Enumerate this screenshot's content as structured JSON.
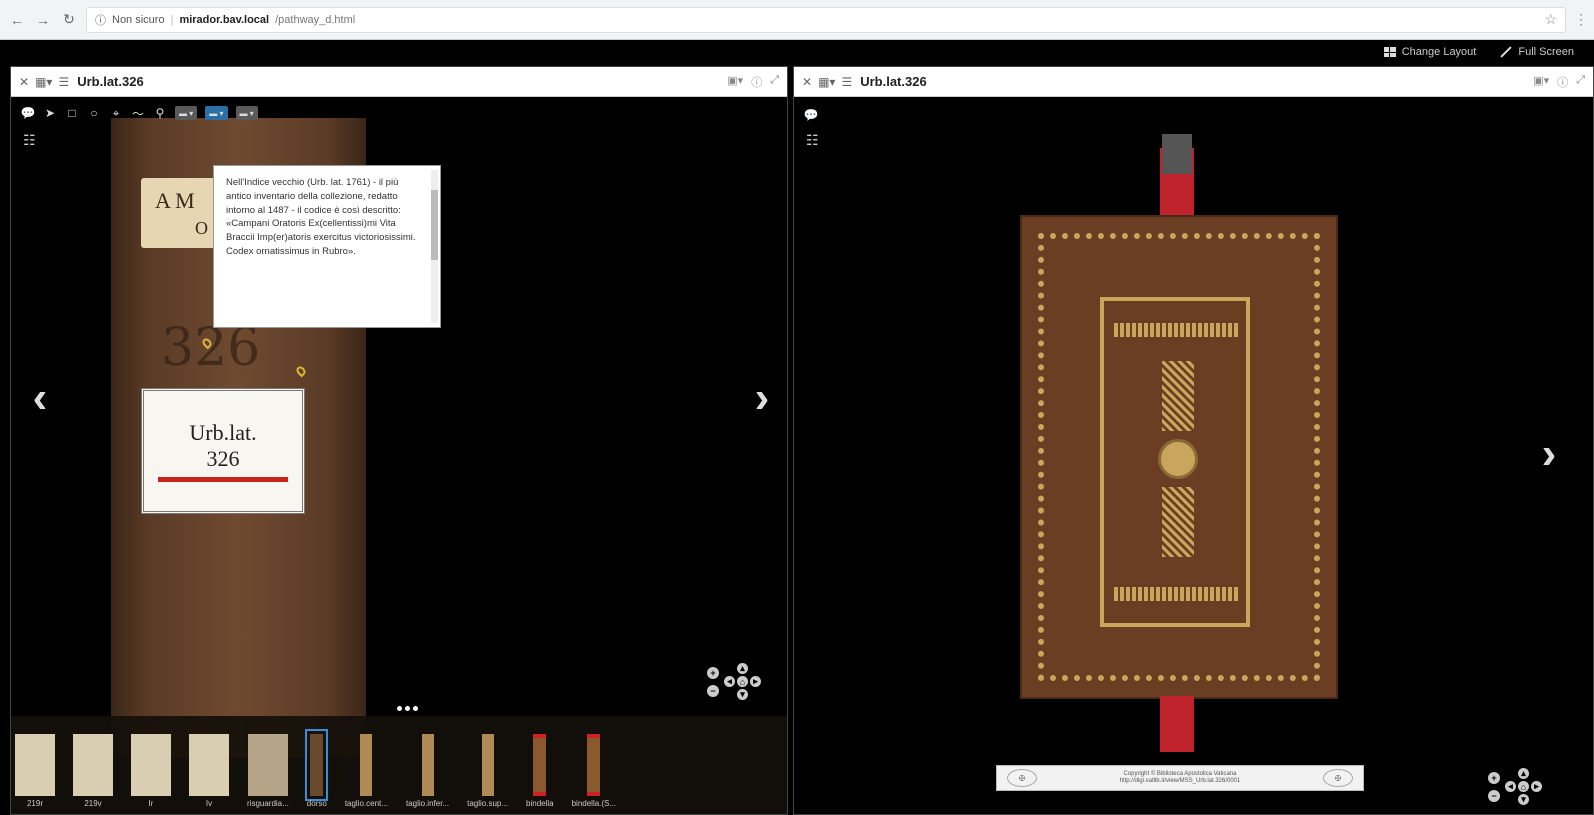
{
  "browser": {
    "security": "Non sicuro",
    "host": "mirador.bav.local",
    "path": "/pathway_d.html"
  },
  "mirador_top": {
    "change_layout": "Change Layout",
    "full_screen": "Full Screen"
  },
  "left_window": {
    "title": "Urb.lat.326",
    "annotation_text": "Nell'Indice vecchio (Urb. lat. 1761) - il più antico inventario della collezione, redatto intorno al 1487 - il codice è così descritto: «Campani Oratoris Ex(cellentissi)mi Vita Braccii Imp(er)atoris exercitus victoriosissimi. Codex ornatissimus in Rubro».",
    "shelfmark_line1": "Urb.lat.",
    "shelfmark_line2": "326",
    "spine_label_top": "A M",
    "spine_label_top2": "O",
    "handwritten": "326",
    "thumbnails": [
      {
        "label": "219r",
        "kind": "page"
      },
      {
        "label": "219v",
        "kind": "page"
      },
      {
        "label": "Ir",
        "kind": "page"
      },
      {
        "label": "Iv",
        "kind": "page"
      },
      {
        "label": "risguardia...",
        "kind": "cover"
      },
      {
        "label": "dorso",
        "kind": "spine",
        "selected": true
      },
      {
        "label": "taglio.cent...",
        "kind": "edge"
      },
      {
        "label": "taglio.infer...",
        "kind": "edge"
      },
      {
        "label": "taglio.sup...",
        "kind": "edge"
      },
      {
        "label": "bindella",
        "kind": "ribbon"
      },
      {
        "label": "bindella.(S...",
        "kind": "ribbon"
      }
    ]
  },
  "right_window": {
    "title": "Urb.lat.326",
    "copyright_line1": "Copyright © Biblioteca Apostolica Vaticana",
    "copyright_line2": "http://digi.vatlib.it/view/MSS_Urb.lat.326/0001"
  }
}
